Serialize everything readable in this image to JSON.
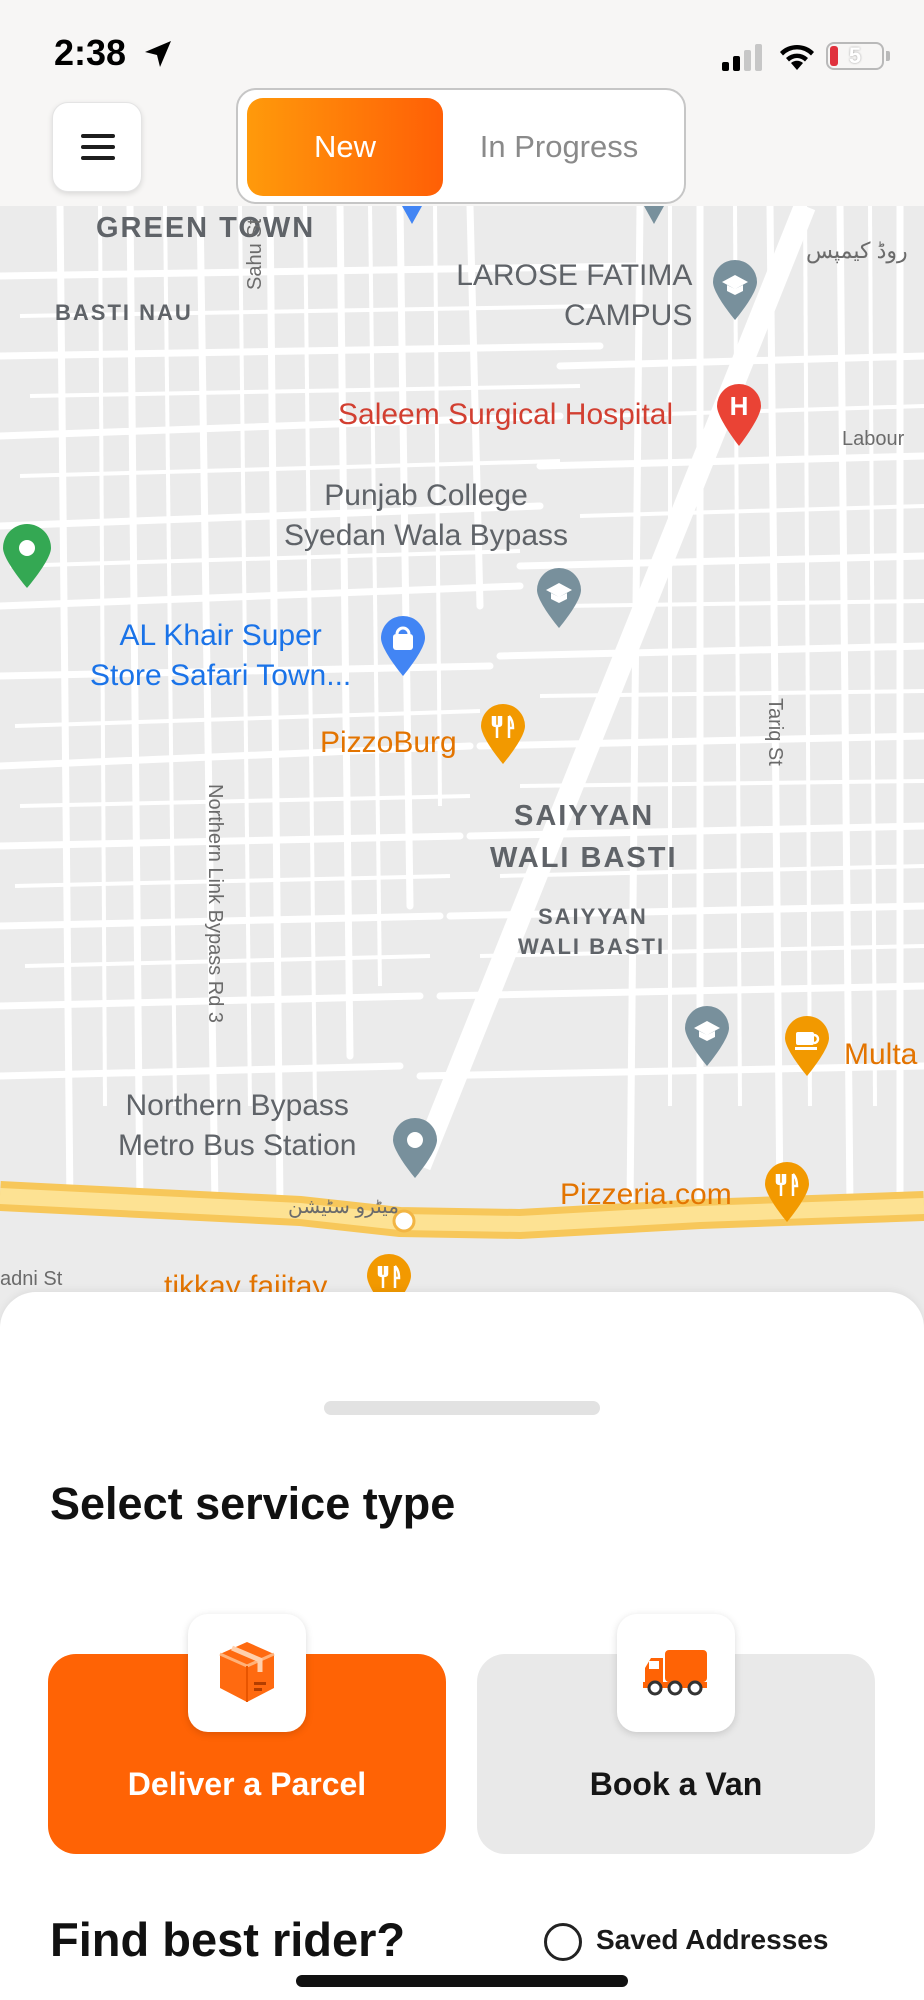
{
  "status_bar": {
    "time": "2:38",
    "battery_level": "5"
  },
  "header": {
    "menu_icon": "hamburger-menu-icon",
    "tabs": [
      {
        "label": "New",
        "active": true
      },
      {
        "label": "In Progress",
        "active": false
      }
    ],
    "accent_gradient": [
      "#ff9a0b",
      "#ff5f06"
    ]
  },
  "map": {
    "areas": [
      "GREEN TOWN",
      "BASTI NAU",
      "SAIYYAN",
      "WALI BASTI",
      "SAIYYAN",
      "WALI BASTI"
    ],
    "streets": [
      "Sahu St",
      "Labour",
      "Tariq St",
      "Northern Link Bypass Rd 3",
      "adni St"
    ],
    "pois": {
      "larose_line1": "LAROSE FATIMA",
      "larose_line2": "CAMPUS",
      "hospital": "Saleem Surgical Hospital",
      "punjab_line1": "Punjab College",
      "punjab_line2": "Syedan Wala Bypass",
      "alkhair_line1": "AL Khair Super",
      "alkhair_line2": "Store Safari Town...",
      "pizzoburg": "PizzoBurg",
      "multa": "Multa",
      "metro_line1": "Northern Bypass",
      "metro_line2": "Metro Bus Station",
      "pizzeria": "Pizzeria.com",
      "tikkay": "tikkay fajitay",
      "urdu_campus": "روڈ کیمپس",
      "urdu_metro": "میٹرو سٹیشن"
    }
  },
  "sheet": {
    "title": "Select service type",
    "services": [
      {
        "label": "Deliver a Parcel",
        "icon": "parcel-box-icon",
        "selected": true,
        "color": "#ff6305"
      },
      {
        "label": "Book a Van",
        "icon": "delivery-van-icon",
        "selected": false,
        "color": "#e9e9e9"
      }
    ],
    "find_rider": "Find best rider?",
    "saved_addresses": "Saved Addresses"
  }
}
